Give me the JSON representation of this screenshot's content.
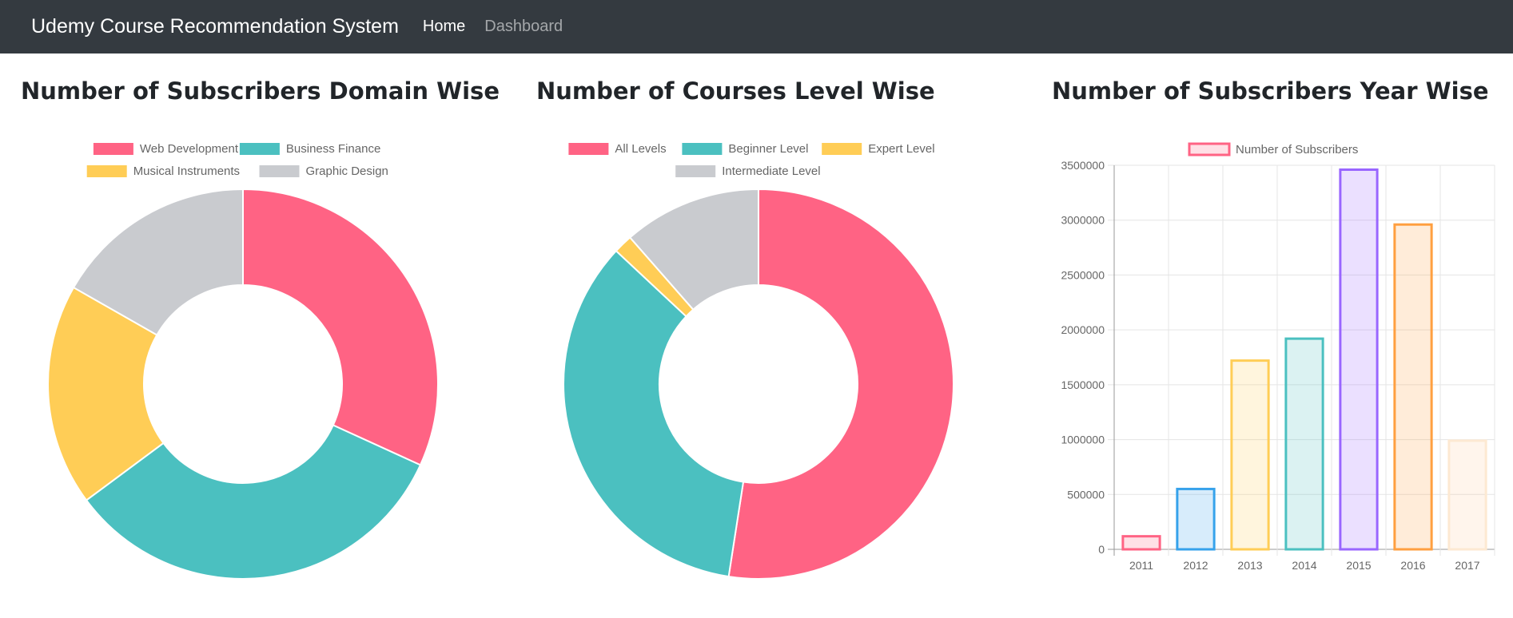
{
  "navbar": {
    "brand": "Udemy Course Recommendation System",
    "links": [
      {
        "label": "Home",
        "active": true
      },
      {
        "label": "Dashboard",
        "active": false
      }
    ]
  },
  "colors": {
    "pink": "#ff6384",
    "teal": "#4bc0c0",
    "yellow": "#ffcd56",
    "grey": "#c9cbcf",
    "blue": "#36a2eb",
    "purple": "#9966ff",
    "orange": "#ff9f40"
  },
  "chart_data": [
    {
      "type": "pie",
      "variant": "doughnut",
      "title": "Number of Subscribers Domain Wise",
      "legend": "top",
      "categories": [
        "Web Development",
        "Business Finance",
        "Musical Instruments",
        "Graphic Design"
      ],
      "values": [
        7980000,
        8280000,
        4620000,
        4200000
      ],
      "colors": [
        "#ff6384",
        "#4bc0c0",
        "#ffcd56",
        "#c9cbcf"
      ]
    },
    {
      "type": "pie",
      "variant": "doughnut",
      "title": "Number of Courses Level Wise",
      "legend": "top",
      "categories": [
        "All Levels",
        "Beginner Level",
        "Expert Level",
        "Intermediate Level"
      ],
      "values": [
        1929,
        1270,
        58,
        421
      ],
      "colors": [
        "#ff6384",
        "#4bc0c0",
        "#ffcd56",
        "#c9cbcf"
      ]
    },
    {
      "type": "bar",
      "title": "Number of Subscribers Year Wise",
      "legend": "top",
      "categories": [
        "2011",
        "2012",
        "2013",
        "2014",
        "2015",
        "2016",
        "2017"
      ],
      "series": [
        {
          "name": "Number of Subscribers",
          "values": [
            119000,
            550000,
            1720000,
            1920000,
            3460000,
            2960000,
            990000
          ]
        }
      ],
      "border_colors": [
        "#ff6384",
        "#36a2eb",
        "#ffcd56",
        "#4bc0c0",
        "#9966ff",
        "#ff9f40",
        "#fde9d2"
      ],
      "fill_colors": [
        "rgba(255,99,132,0.2)",
        "rgba(54,162,235,0.2)",
        "rgba(255,205,86,0.2)",
        "rgba(75,192,192,0.2)",
        "rgba(153,102,255,0.2)",
        "rgba(255,159,64,0.2)",
        "rgba(255,159,64,0.1)"
      ],
      "y_ticks": [
        "0",
        "500000",
        "1000000",
        "1500000",
        "2000000",
        "2500000",
        "3000000",
        "3500000"
      ],
      "ylim": [
        0,
        3500000
      ],
      "grid": true
    }
  ]
}
